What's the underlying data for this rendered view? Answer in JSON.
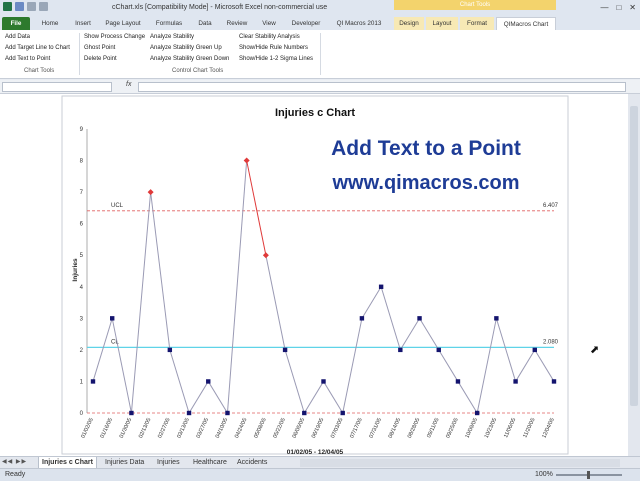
{
  "window": {
    "title": "cChart.xls  [Compatibility Mode] - Microsoft Excel non-commercial use",
    "contextual_banner": "Chart Tools"
  },
  "tabs": [
    "File",
    "Home",
    "Insert",
    "Page Layout",
    "Formulas",
    "Data",
    "Review",
    "View",
    "Developer",
    "QI Macros 2013",
    "Design",
    "Layout",
    "Format",
    "QIMacros Chart"
  ],
  "ribbon": {
    "chart_tools": {
      "items": [
        "Add Data",
        "Add Target Line to Chart",
        "Add Text to Point"
      ],
      "label": "Chart Tools"
    },
    "control_chart_tools": {
      "col1": [
        "Show Process Change",
        "Ghost Point",
        "Delete Point"
      ],
      "col2": [
        "Analyze Stability",
        "Analyze Stability Green Up",
        "Analyze Stability Green Down"
      ],
      "col3": [
        "Clear Stability Analysis",
        "Show/Hide Rule Numbers",
        "Show/Hide 1-2 Sigma Lines"
      ],
      "label": "Control Chart Tools"
    }
  },
  "formula_bar": {
    "fx": "fx",
    "namebox": "",
    "value": ""
  },
  "chart_data": {
    "type": "line",
    "title": "Injuries c Chart",
    "ylabel": "Injuries",
    "xlabel": "01/02/05 - 12/04/05",
    "ylim": [
      0,
      9
    ],
    "yticks": [
      0,
      1,
      2,
      3,
      4,
      5,
      6,
      7,
      8,
      9
    ],
    "categories": [
      "01/02/05",
      "01/16/05",
      "01/30/05",
      "02/13/05",
      "02/27/05",
      "03/13/05",
      "03/27/05",
      "04/10/05",
      "04/24/05",
      "05/08/05",
      "05/22/05",
      "06/05/05",
      "06/19/05",
      "07/03/05",
      "07/17/05",
      "07/31/05",
      "08/14/05",
      "08/28/05",
      "09/11/05",
      "09/25/05",
      "10/09/05",
      "10/23/05",
      "11/06/05",
      "11/20/05",
      "12/04/05"
    ],
    "x_tick_labels": [
      "01/02/05",
      "01/16/05",
      "01/30/05",
      "02/13/05",
      "02/27/05",
      "03/13/05",
      "03/27/05",
      "04/10/05",
      "04/24/05",
      "05/08/05",
      "05/22/05",
      "06/05/05",
      "06/19/05",
      "07/03/05",
      "07/17/05",
      "07/31/05",
      "08/14/05",
      "08/28/05",
      "09/11/05",
      "09/25/05",
      "10/09/05",
      "10/23/05",
      "11/06/05",
      "11/20/05",
      "12/04/05"
    ],
    "values": [
      1,
      3,
      0,
      7,
      2,
      0,
      1,
      0,
      8,
      5,
      2,
      0,
      1,
      0,
      3,
      4,
      2,
      3,
      2,
      1,
      0,
      3,
      1,
      2,
      1
    ],
    "out_of_control": [
      3,
      8,
      9
    ],
    "ucl": {
      "label": "UCL",
      "value": 6.407,
      "value_label": "6.407"
    },
    "cl": {
      "label": "CL",
      "value": 2.08,
      "value_label": "2.080"
    },
    "lcl": {
      "value": 0
    },
    "annotation": {
      "line1": "Add Text to a Point",
      "line2": "www.qimacros.com"
    },
    "colors": {
      "series": "#9a9ab4",
      "marker": "#14146e",
      "ooc": "#e03a3a",
      "ucl": "#e06060",
      "cl": "#5fd3e8",
      "annotation": "#1e3c96"
    }
  },
  "sheet_tabs": [
    "Injuries c Chart",
    "Injuries Data",
    "Injuries",
    "Healthcare",
    "Accidents"
  ],
  "status": {
    "ready": "Ready",
    "zoom": "100%"
  }
}
